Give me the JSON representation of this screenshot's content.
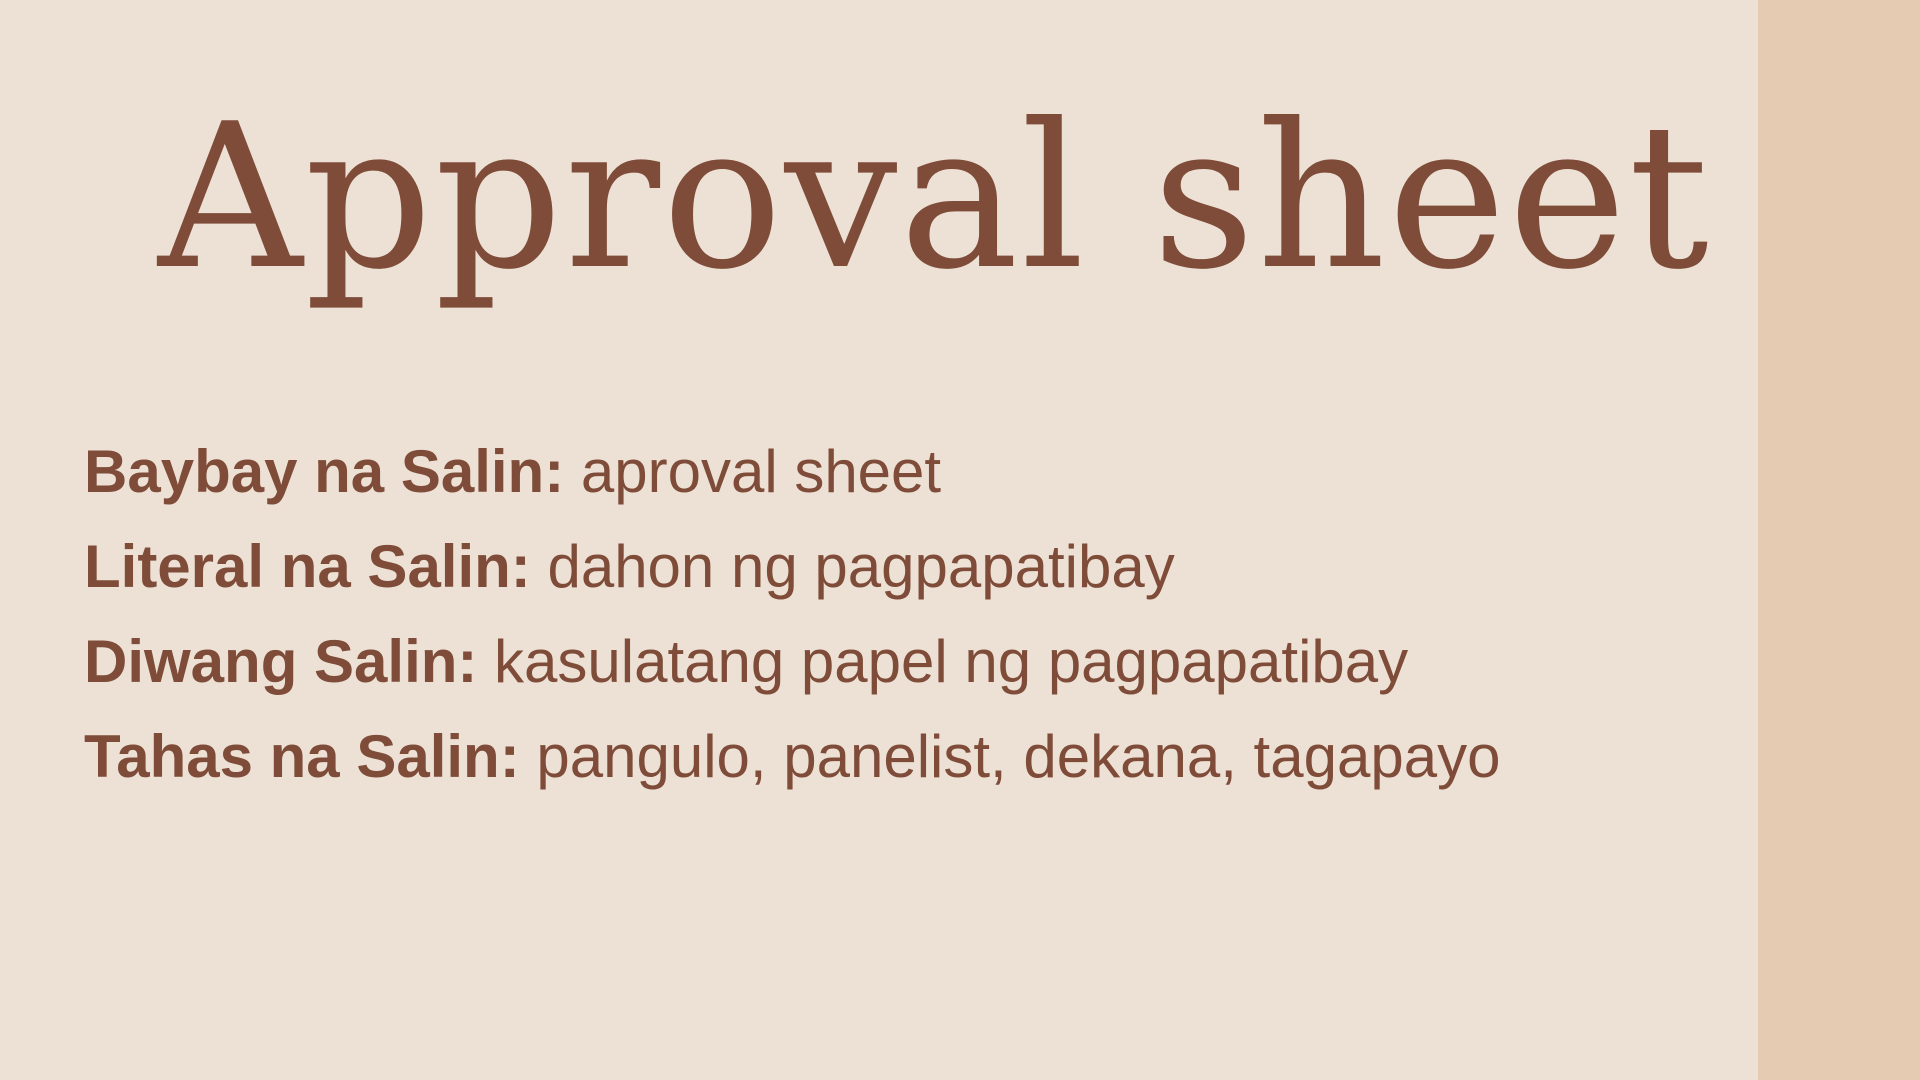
{
  "slide": {
    "title": "Approval sheet",
    "colors": {
      "background": "#ede1d6",
      "side_band": "#e4cbb2",
      "text": "#7e4c38"
    },
    "terms": [
      {
        "label": "Baybay na Salin:",
        "value": "aproval sheet"
      },
      {
        "label": "Literal na Salin:",
        "value": "dahon ng pagpapatibay"
      },
      {
        "label": "Diwang Salin:",
        "value": "kasulatang papel ng pagpapatibay"
      },
      {
        "label": "Tahas na Salin:",
        "value": "pangulo, panelist, dekana, tagapayo"
      }
    ]
  }
}
